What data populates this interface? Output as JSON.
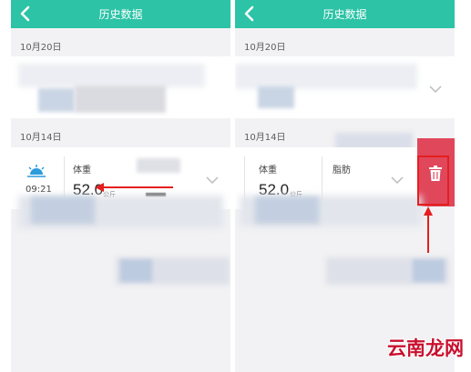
{
  "screens": [
    {
      "title": "历史数据",
      "date_1": "10月20日",
      "date_2": "10月14日",
      "record": {
        "time": "09:21",
        "label_weight": "体重",
        "weight_value": "52.0",
        "weight_unit": "公斤"
      }
    },
    {
      "title": "历史数据",
      "date_1": "10月20日",
      "date_2": "10月14日",
      "record": {
        "label_weight": "体重",
        "weight_value": "52.0",
        "weight_unit": "公斤",
        "label_fat": "脂肪"
      }
    }
  ],
  "colors": {
    "header": "#2cc3a6",
    "delete": "#e0475b",
    "annotation_arrow": "#e41f1f",
    "sun_icon": "#2d9cdb"
  },
  "icons": [
    "back-arrow-icon",
    "chevron-down-icon",
    "sun-icon",
    "trash-icon"
  ],
  "watermark": "云南龙网"
}
